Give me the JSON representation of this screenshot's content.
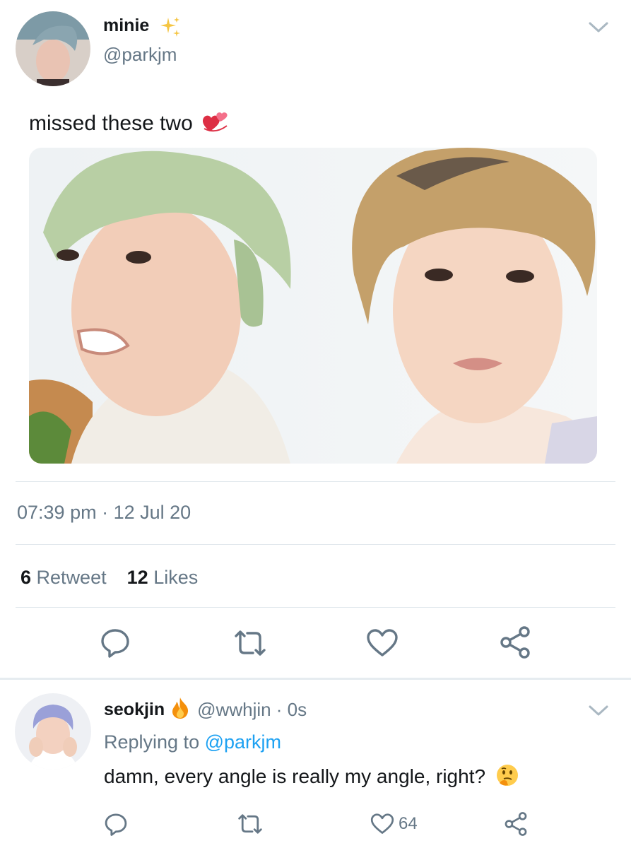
{
  "tweet": {
    "author_name": "minie",
    "author_emoji": "sparkles",
    "handle": "@parkjm",
    "text": "missed these two",
    "text_emoji": "revolving-hearts",
    "timestamp": "07:39 pm · 12 Jul 20",
    "retweet_count": "6",
    "retweet_label": "Retweet",
    "likes_count": "12",
    "likes_label": "Likes"
  },
  "reply": {
    "author_name": "seokjin",
    "author_emoji": "fire",
    "handle_time": "@wwhjin · 0s",
    "replying_prefix": "Replying to ",
    "replying_to": "@parkjm",
    "text": "damn, every angle is really my angle, right?",
    "text_emoji": "thinking-face",
    "like_count": "64"
  },
  "colors": {
    "text": "#14171a",
    "secondary": "#657786",
    "link": "#1da1f2",
    "divider": "#e1e8ed"
  }
}
